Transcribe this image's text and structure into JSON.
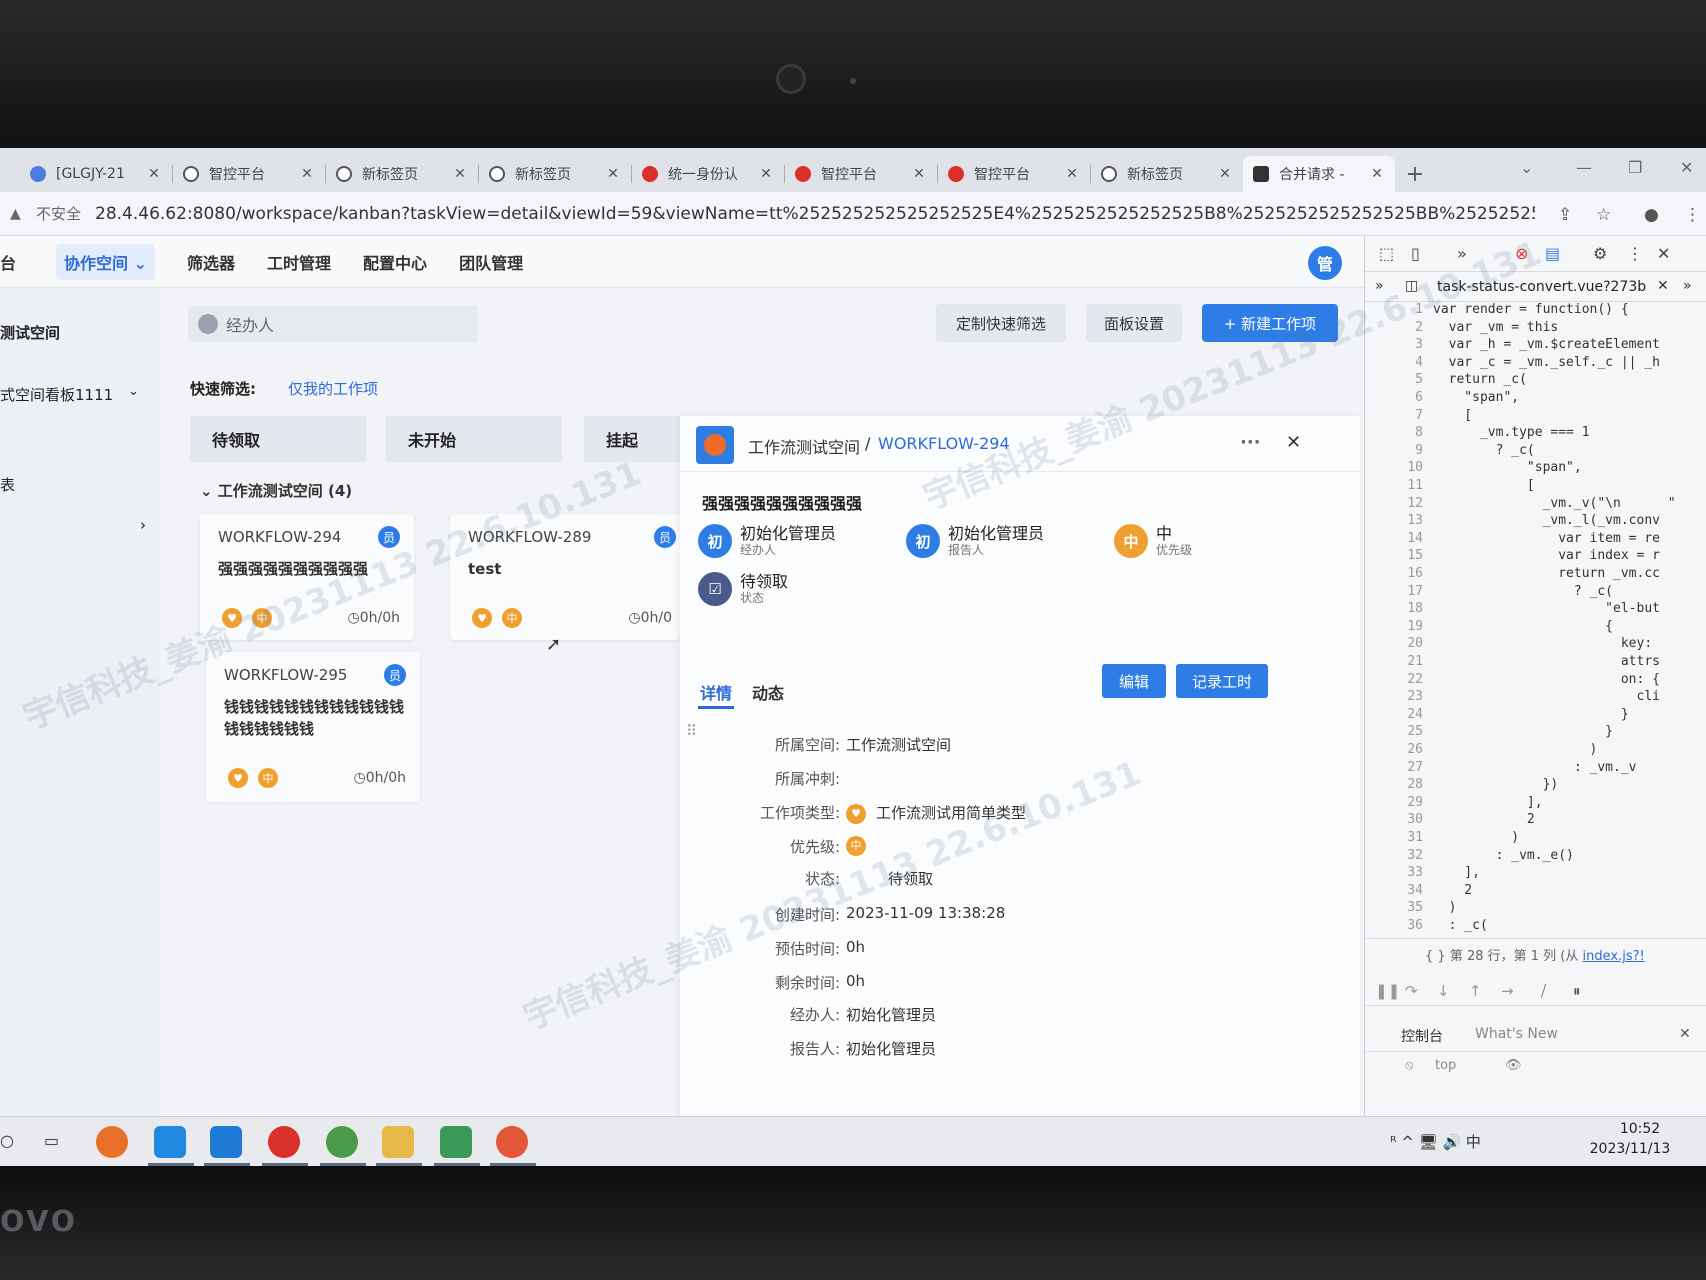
{
  "device": {
    "brand": "ovo"
  },
  "browser": {
    "tabs": [
      {
        "label": "[GLGJY-21",
        "icon": "jira-icon",
        "color": "#4c7de0",
        "active": false
      },
      {
        "label": "智控平台",
        "icon": "globe-icon",
        "color": "#555555",
        "active": false
      },
      {
        "label": "新标签页",
        "icon": "chrome-icon",
        "color": "#555555",
        "active": false
      },
      {
        "label": "新标签页",
        "icon": "chrome-icon",
        "color": "#555555",
        "active": false
      },
      {
        "label": "统一身份认",
        "icon": "red-logo-icon",
        "color": "#d9302c",
        "active": false
      },
      {
        "label": "智控平台",
        "icon": "red-logo-icon",
        "color": "#d9302c",
        "active": false
      },
      {
        "label": "智控平台",
        "icon": "red-logo-icon",
        "color": "#d9302c",
        "active": false
      },
      {
        "label": "新标签页",
        "icon": "chrome-icon",
        "color": "#555555",
        "active": false
      },
      {
        "label": "合并请求 -",
        "icon": "gitlab-icon",
        "color": "#333333",
        "active": true
      }
    ],
    "new_tab": "+",
    "address": {
      "security": "不安全",
      "url": "28.4.46.62:8080/workspace/kanban?taskView=detail&viewId=59&viewName=tt%252525252525252525E4%2525252525252525B8%2525252525252525BB%2525252525252525E9..."
    }
  },
  "app": {
    "nav": {
      "brand_fragment": "台",
      "items": [
        "协作空间",
        "筛选器",
        "工时管理",
        "配置中心",
        "团队管理"
      ],
      "active_index": 0,
      "avatar": "管"
    },
    "sidebar": {
      "items": [
        "测试空间",
        "式空间看板1111",
        "表"
      ]
    },
    "toolbar": {
      "assignee_placeholder": "经办人",
      "custom_filter": "定制快速筛选",
      "panel_settings": "面板设置",
      "new_item": "+ 新建工作项"
    },
    "quick_filter": {
      "label": "快速筛选:",
      "link": "仅我的工作项"
    },
    "columns": [
      "待领取",
      "未开始",
      "挂起"
    ],
    "group": {
      "title": "工作流测试空间 (4)"
    },
    "cards": [
      {
        "id": "WORKFLOW-294",
        "title": "强强强强强强强强强强",
        "role": "员",
        "type": "♥",
        "priority": "中",
        "time": "0h/0h"
      },
      {
        "id": "WORKFLOW-289",
        "title": "test",
        "role": "员",
        "type": "♥",
        "priority": "中",
        "time": "0h/0"
      },
      {
        "id": "WORKFLOW-295",
        "title": "钱钱钱钱钱钱钱钱钱钱钱钱钱钱钱钱钱钱",
        "role": "员",
        "type": "♥",
        "priority": "中",
        "time": "0h/0h"
      }
    ],
    "detail": {
      "space": "工作流测试空间",
      "separator": "/",
      "item_id": "WORKFLOW-294",
      "more": "···",
      "close": "✕",
      "title": "强强强强强强强强强强",
      "people": [
        {
          "avatar": "初",
          "name": "初始化管理员",
          "role": "经办人",
          "color": "#2e7de6"
        },
        {
          "avatar": "初",
          "name": "初始化管理员",
          "role": "报告人",
          "color": "#2e7de6"
        },
        {
          "avatar": "中",
          "name": "中",
          "role": "优先级",
          "color": "#f0a030"
        },
        {
          "avatar": "☑",
          "name": "待领取",
          "role": "状态",
          "color": "#4a5a8a"
        }
      ],
      "tabs": [
        "详情",
        "动态"
      ],
      "buttons": {
        "edit": "编辑",
        "log_time": "记录工时"
      },
      "fields": [
        {
          "label": "所属空间:",
          "value": "工作流测试空间"
        },
        {
          "label": "所属冲刺:",
          "value": ""
        },
        {
          "label": "工作项类型:",
          "value": "工作流测试用简单类型",
          "icon": "♥"
        },
        {
          "label": "优先级:",
          "value": "",
          "icon": "中"
        },
        {
          "label": "状态:",
          "value": "待领取"
        },
        {
          "label": "创建时间:",
          "value": "2023-11-09 13:38:28"
        },
        {
          "label": "预估时间:",
          "value": "0h"
        },
        {
          "label": "剩余时间:",
          "value": "0h"
        },
        {
          "label": "经办人:",
          "value": "初始化管理员"
        },
        {
          "label": "报告人:",
          "value": "初始化管理员"
        }
      ]
    }
  },
  "devtools": {
    "file": "task-status-convert.vue?273b",
    "code": [
      "var render = function() {",
      "  var _vm = this",
      "  var _h = _vm.$createElement",
      "  var _c = _vm._self._c || _h",
      "  return _c(",
      "    \"span\",",
      "    [",
      "      _vm.type === 1",
      "        ? _c(",
      "            \"span\",",
      "            [",
      "              _vm._v(\"\\n      \"",
      "              _vm._l(_vm.conv",
      "                var item = re",
      "                var index = r",
      "                return _vm.cc",
      "                  ? _c(",
      "                      \"el-but",
      "                      {",
      "                        key:",
      "                        attrs",
      "                        on: {",
      "                          cli",
      "                        }",
      "                      }",
      "                    )",
      "                  : _vm._v",
      "              })",
      "            ],",
      "            2",
      "          )",
      "        : _vm._e()",
      "    ],",
      "    2",
      "  )",
      "  : _c("
    ],
    "status": {
      "position": "第 28 行，第 1 列",
      "source_prefix": "(从",
      "source_link": "index.js?!"
    },
    "drawer_tabs": [
      "控制台",
      "What's New"
    ],
    "console_context": "top"
  },
  "taskbar": {
    "apps": [
      {
        "icon": "firefox-icon",
        "color": "#e8702a"
      },
      {
        "icon": "webstorm-icon",
        "color": "#1f8ae0"
      },
      {
        "icon": "vscode-icon",
        "color": "#1f7ad6"
      },
      {
        "icon": "red-app-icon",
        "color": "#d9302c"
      },
      {
        "icon": "chrome-icon",
        "color": "#4a9a4a"
      },
      {
        "icon": "folder-icon",
        "color": "#e6b84a"
      },
      {
        "icon": "books-icon",
        "color": "#3a9a5a"
      },
      {
        "icon": "slash-app-icon",
        "color": "#e2563a"
      }
    ],
    "tray": "ᴿ ^ 🖥 🔊 中",
    "time": "10:52",
    "date": "2023/11/13"
  },
  "watermark": {
    "text": "宇信科技_姜渝 20231113 22.6.10.131"
  }
}
